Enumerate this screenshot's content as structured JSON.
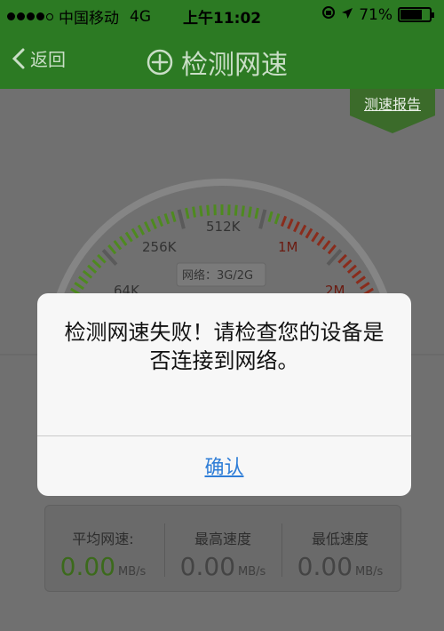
{
  "status_bar": {
    "carrier": "中国移动",
    "network": "4G",
    "time": "上午11:02",
    "battery": "71%",
    "battery_level": 0.71
  },
  "nav": {
    "back_label": "返回",
    "title": "检测网速"
  },
  "report_tag": "测速报告",
  "gauge": {
    "labels": [
      "64K",
      "256K",
      "512K",
      "1M",
      "2M"
    ],
    "network_type": "网络：3G/2G"
  },
  "stats": {
    "avg_label": "平均网速:",
    "avg_value": "0.00",
    "max_label": "最高速度",
    "max_value": "0.00",
    "min_label": "最低速度",
    "min_value": "0.00",
    "unit": "MB/s"
  },
  "alert": {
    "message": "检测网速失败！请检查您的设备是否连接到网络。",
    "confirm": "确认"
  },
  "colors": {
    "nav_green": "#2c7a23",
    "green_tick": "#4e8a1f",
    "red_tick": "#8a2c1c",
    "link_blue": "#2e7dd7"
  }
}
